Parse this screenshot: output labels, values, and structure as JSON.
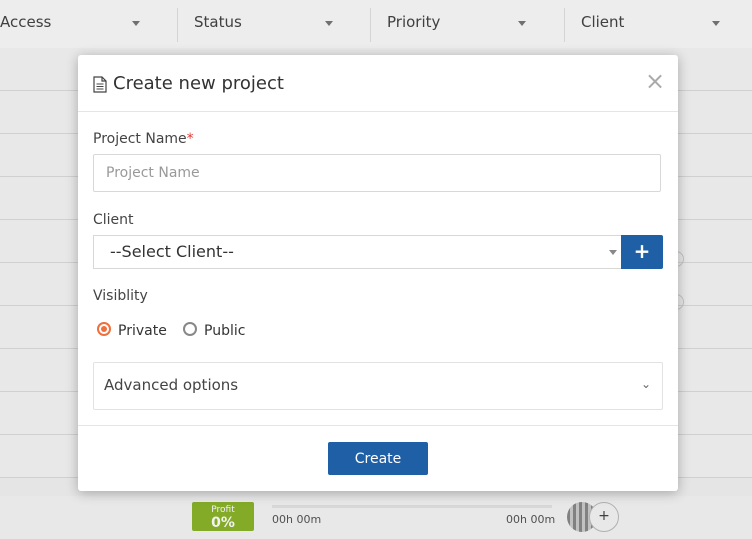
{
  "filters": [
    {
      "label": "Access"
    },
    {
      "label": "Status"
    },
    {
      "label": "Priority"
    },
    {
      "label": "Client"
    }
  ],
  "background_row": {
    "profit_label": "Profit",
    "profit_value": "0%",
    "time_left": "00h 00m",
    "time_right": "00h 00m",
    "add_symbol": "+"
  },
  "modal": {
    "title": "Create new project",
    "close_symbol": "×",
    "project_name": {
      "label": "Project Name",
      "required_mark": "*",
      "placeholder": "Project Name",
      "value": ""
    },
    "client": {
      "label": "Client",
      "selected": "--Select Client--",
      "add_button": "+"
    },
    "visibility": {
      "label": "Visiblity",
      "options": [
        {
          "label": "Private",
          "checked": true
        },
        {
          "label": "Public",
          "checked": false
        }
      ]
    },
    "advanced_options": {
      "label": "Advanced options",
      "chevron": "⌄"
    },
    "create_button": "Create"
  },
  "colors": {
    "primary": "#1f5fa5",
    "radio_accent": "#f06f3a",
    "profit_badge": "#8bb52a",
    "required": "#e53935"
  }
}
